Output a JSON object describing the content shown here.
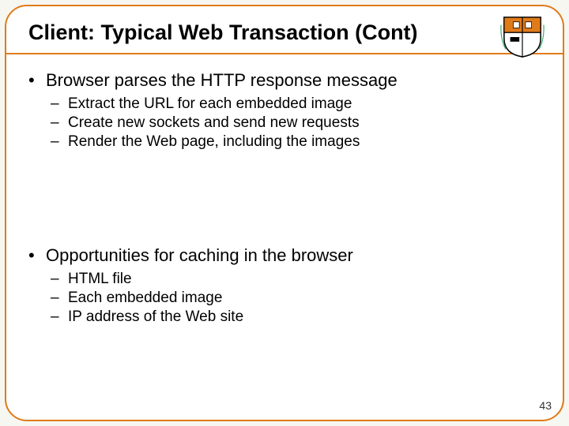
{
  "slide": {
    "title": "Client: Typical Web Transaction (Cont)",
    "page_number": "43",
    "bullets": {
      "b1": {
        "text": "Browser parses the HTTP response message",
        "sub": {
          "s1": "Extract the URL for each embedded image",
          "s2": "Create new sockets and send new requests",
          "s3": "Render the Web page, including the images"
        }
      },
      "b2": {
        "text": "Opportunities for caching in the browser",
        "sub": {
          "s1": "HTML file",
          "s2": "Each embedded image",
          "s3": "IP address of the Web site"
        }
      }
    },
    "glyphs": {
      "dot": "•",
      "dash": "–"
    }
  }
}
